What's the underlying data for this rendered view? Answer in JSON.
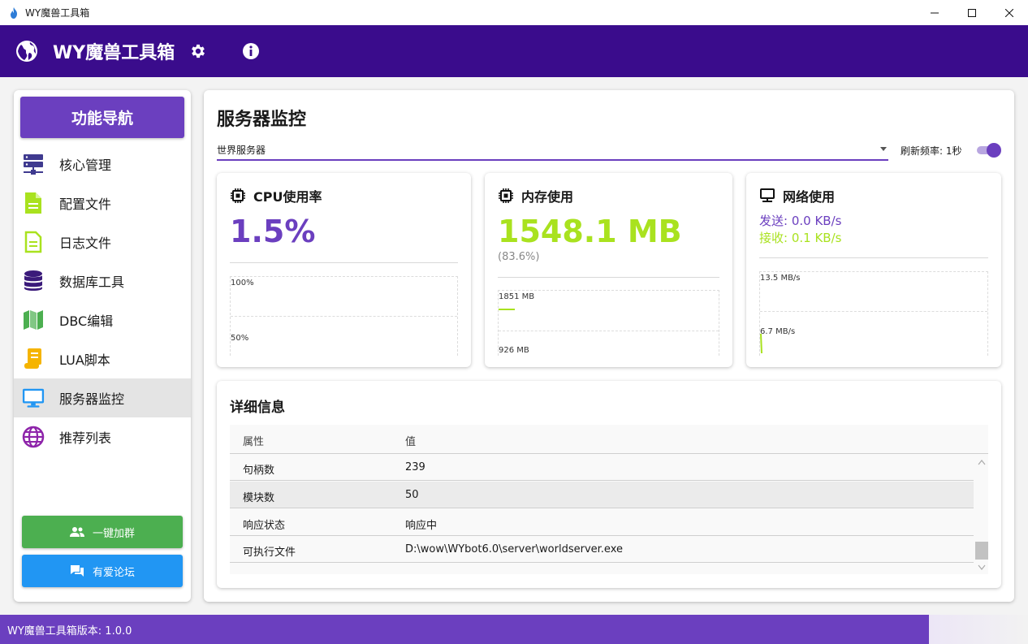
{
  "window": {
    "title": "WY魔兽工具箱",
    "controls": [
      "minimize",
      "maximize",
      "close"
    ]
  },
  "header": {
    "app_name": "WY魔兽工具箱",
    "icons": [
      "globe-icon",
      "gear-icon",
      "info-icon"
    ]
  },
  "sidebar": {
    "title": "功能导航",
    "items": [
      {
        "label": "核心管理",
        "icon": "server-icon",
        "color": "#3f3a8f"
      },
      {
        "label": "配置文件",
        "icon": "file-icon",
        "color": "#a9e21f"
      },
      {
        "label": "日志文件",
        "icon": "file-text-icon",
        "color": "#a9e21f"
      },
      {
        "label": "数据库工具",
        "icon": "database-icon",
        "color": "#3a1a7a"
      },
      {
        "label": "DBC编辑",
        "icon": "map-icon",
        "color": "#4caf50"
      },
      {
        "label": "LUA脚本",
        "icon": "scroll-icon",
        "color": "#f5b400"
      },
      {
        "label": "服务器监控",
        "icon": "monitor-icon",
        "color": "#2196f3",
        "active": true
      },
      {
        "label": "推荐列表",
        "icon": "globe-icon",
        "color": "#8e24aa"
      }
    ],
    "buttons": {
      "group": "一键加群",
      "forum": "有爱论坛"
    }
  },
  "main": {
    "title": "服务器监控",
    "server_select": "世界服务器",
    "refresh_label": "刷新频率: 1秒",
    "refresh_enabled": true,
    "cpu": {
      "title": "CPU使用率",
      "value": "1.5%",
      "chart_top": "100%",
      "chart_mid": "50%"
    },
    "memory": {
      "title": "内存使用",
      "value": "1548.1 MB",
      "percent": "(83.6%)",
      "chart_top": "1851 MB",
      "chart_mid": "926 MB"
    },
    "network": {
      "title": "网络使用",
      "send": "发送: 0.0 KB/s",
      "recv": "接收: 0.1 KB/s",
      "chart_top": "13.5 MB/s",
      "chart_mid": "6.7 MB/s"
    },
    "details": {
      "title": "详细信息",
      "columns": [
        "属性",
        "值"
      ],
      "rows": [
        {
          "key": "句柄数",
          "value": "239"
        },
        {
          "key": "模块数",
          "value": "50"
        },
        {
          "key": "响应状态",
          "value": "响应中"
        },
        {
          "key": "可执行文件",
          "value": "D:\\wow\\WYbot6.0\\server\\worldserver.exe"
        }
      ]
    }
  },
  "footer": {
    "version": "WY魔兽工具箱版本: 1.0.0"
  },
  "colors": {
    "header_bg": "#3a0c8c",
    "accent": "#6b3fbf",
    "cpu_value": "#6b3fbf",
    "memory_value": "#a9e21f",
    "send_color": "#6b3fbf",
    "recv_color": "#a9e21f",
    "group_button": "#4caf50",
    "forum_button": "#2196f3"
  }
}
